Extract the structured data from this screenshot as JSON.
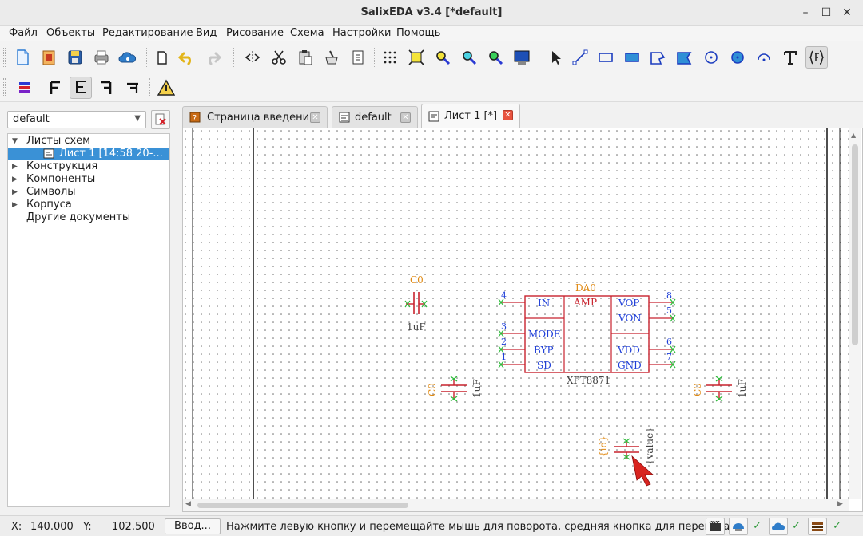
{
  "window": {
    "title": "SalixEDA v3.4 [*default]"
  },
  "menu": [
    "Файл",
    "Объекты",
    "Редактирование",
    "Вид",
    "Рисование",
    "Схема",
    "Настройки",
    "Помощь"
  ],
  "project": {
    "selector_value": "default"
  },
  "tree": {
    "items": [
      {
        "label": "Листы схем",
        "expanded": true
      },
      {
        "label": "Лист 1 [14:58 20-...",
        "selected": true
      },
      {
        "label": "Конструкция"
      },
      {
        "label": "Компоненты"
      },
      {
        "label": "Символы"
      },
      {
        "label": "Корпуса"
      },
      {
        "label": "Другие документы"
      }
    ]
  },
  "tabs": [
    {
      "label": "Страница введения"
    },
    {
      "label": "default"
    },
    {
      "label": "Лист 1 [*]",
      "active": true
    }
  ],
  "schematic": {
    "cap_top": {
      "id": "C0",
      "value": "1uF"
    },
    "cap_left": {
      "id": "C0",
      "value": "1uF"
    },
    "cap_right": {
      "id": "C0",
      "value": "1uF"
    },
    "cap_cursor": {
      "id": "{id}",
      "value": "{value}"
    },
    "chip": {
      "ref": "DA0",
      "name": "XPT8871",
      "func": "AMP",
      "pins_left": [
        {
          "num": "4",
          "name": "IN"
        },
        {
          "num": "3",
          "name": "MODE"
        },
        {
          "num": "2",
          "name": "BYP"
        },
        {
          "num": "1",
          "name": "SD"
        }
      ],
      "pins_right": [
        {
          "num": "8",
          "name": "VOP"
        },
        {
          "num": "5",
          "name": "VON"
        },
        {
          "num": "6",
          "name": "VDD"
        },
        {
          "num": "7",
          "name": "GND"
        }
      ]
    }
  },
  "status": {
    "x_label": "X:",
    "x_value": "140.000",
    "y_label": "Y:",
    "y_value": "102.500",
    "input_button": "Ввод...",
    "message": "Нажмите левую кнопку и перемещайте мышь для поворота, средняя кнопка для переноса",
    "check": "✓"
  },
  "colors": {
    "component": "#c8222d",
    "pin_text": "#1f3fd8",
    "ref_text": "#e08a14",
    "value_text": "#444444",
    "pin_end": "#2dbb3a",
    "selection": "#3a91d6"
  }
}
